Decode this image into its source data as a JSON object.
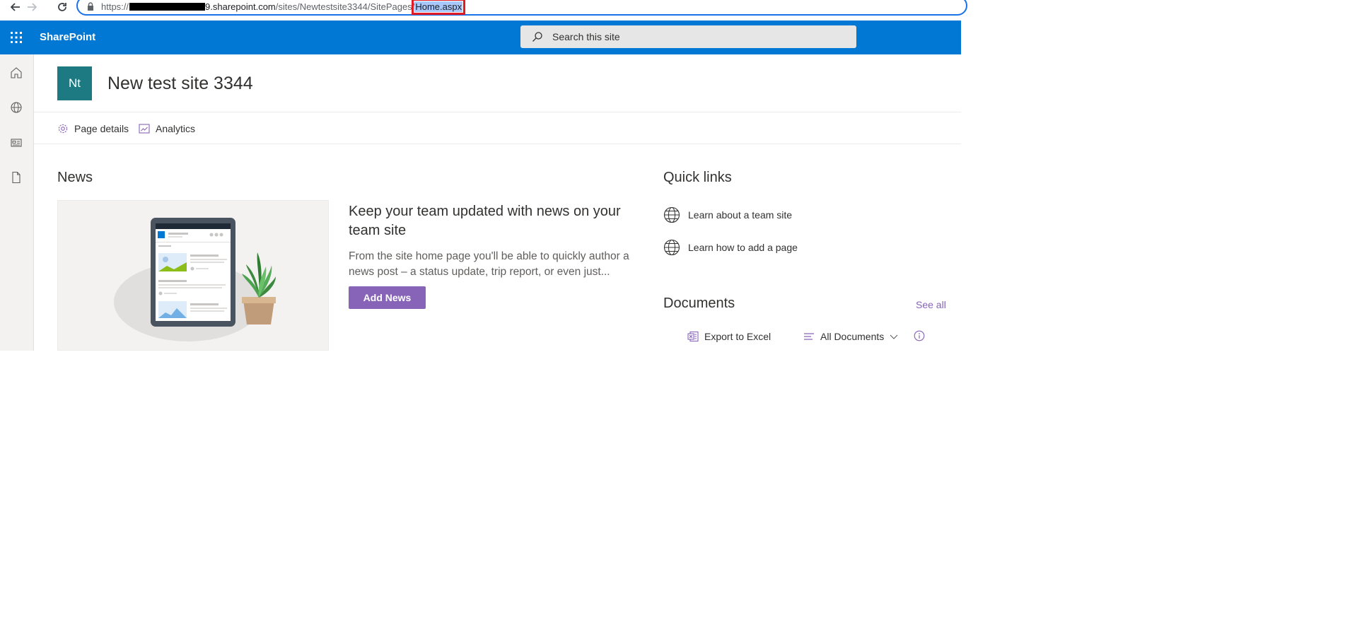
{
  "browser": {
    "url_prefix": "https://",
    "url_host_suffix": "9.sharepoint.com",
    "url_path": "/sites/Newtestsite3344/SitePages/",
    "url_selected": "Home.aspx"
  },
  "suite": {
    "brand": "SharePoint",
    "search_placeholder": "Search this site"
  },
  "site": {
    "logo_initials": "Nt",
    "title": "New test site 3344"
  },
  "commands": {
    "page_details": "Page details",
    "analytics": "Analytics"
  },
  "news": {
    "title": "News",
    "heading": "Keep your team updated with news on your team site",
    "body": "From the site home page you'll be able to quickly author a news post – a status update, trip report, or even just...",
    "add_button": "Add News"
  },
  "quick_links": {
    "title": "Quick links",
    "items": [
      {
        "label": "Learn about a team site"
      },
      {
        "label": "Learn how to add a page"
      }
    ]
  },
  "documents": {
    "title": "Documents",
    "see_all": "See all",
    "export": "Export to Excel",
    "view": "All Documents"
  },
  "colors": {
    "suite_bar": "#0078d4",
    "accent": "#8764b8",
    "site_logo": "#1e7a82"
  }
}
